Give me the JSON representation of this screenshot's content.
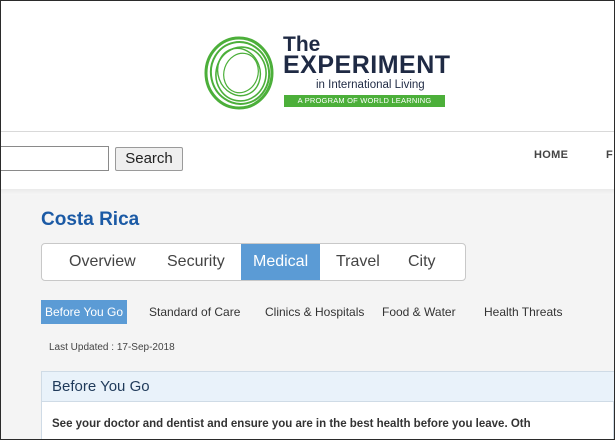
{
  "header": {
    "logo": {
      "line1": "The",
      "line2": "EXPERIMENT",
      "line3": "in International Living",
      "band": "A PROGRAM OF WORLD LEARNING",
      "colors": {
        "green": "#4caf3a",
        "navy": "#1f2a44"
      }
    },
    "search": {
      "value": "",
      "placeholder": "",
      "button_label": "Search"
    },
    "nav": {
      "items": [
        "HOME",
        "F"
      ]
    }
  },
  "page": {
    "title": "Costa Rica",
    "tabs": [
      {
        "label": "Overview",
        "active": false
      },
      {
        "label": "Security",
        "active": false
      },
      {
        "label": "Medical",
        "active": true
      },
      {
        "label": "Travel",
        "active": false
      },
      {
        "label": "City",
        "active": false
      }
    ],
    "subtabs": [
      {
        "label": "Before You Go",
        "active": true
      },
      {
        "label": "Standard of Care",
        "active": false
      },
      {
        "label": "Clinics & Hospitals",
        "active": false
      },
      {
        "label": "Food & Water",
        "active": false
      },
      {
        "label": "Health Threats",
        "active": false
      }
    ],
    "last_updated": "Last Updated : 17-Sep-2018",
    "section": {
      "title": "Before You Go",
      "body": "See your doctor and dentist and ensure you are in the best health before you leave. Oth"
    }
  },
  "colors": {
    "accent": "#5b9bd5",
    "title_blue": "#1b5aa5"
  }
}
